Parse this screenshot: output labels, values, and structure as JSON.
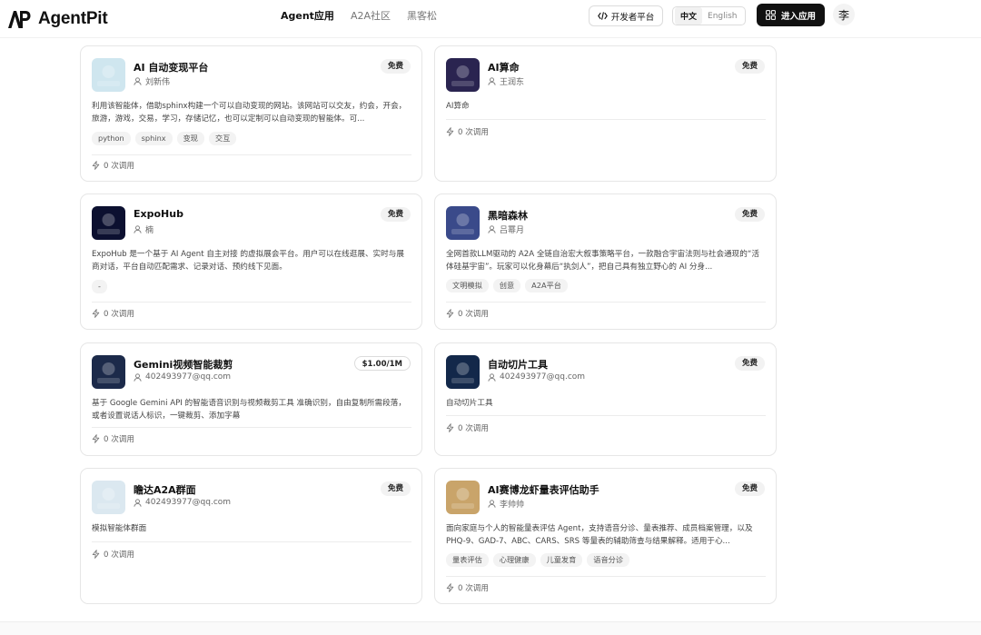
{
  "brand": {
    "name": "AgentPit"
  },
  "nav": {
    "items": [
      "Agent应用",
      "A2A社区",
      "黑客松"
    ]
  },
  "header": {
    "dev_platform": "开发者平台",
    "lang_zh": "中文",
    "lang_en": "English",
    "enter_app": "进入应用",
    "avatar": "李"
  },
  "cards": [
    {
      "title": "AI 自动变现平台",
      "author": "刘新伟",
      "price": "免费",
      "description": "利用该智能体，借助sphinx构建一个可以自动变现的网站。该网站可以交友，约会，开会，旅游，游戏，交易，学习，存储记忆，也可以定制可以自动变现的智能体。可...",
      "tags": [
        "python",
        "sphinx",
        "变现",
        "交互"
      ],
      "calls": "0 次调用",
      "thumb_color": "#cfe6ef"
    },
    {
      "title": "AI算命",
      "author": "王润东",
      "price": "免费",
      "description": "AI算命",
      "tags": [],
      "calls": "0 次调用",
      "thumb_color": "#2a2450"
    },
    {
      "title": "ExpoHub",
      "author": "楠",
      "price": "免费",
      "description": "ExpoHub 是一个基于 AI Agent 自主对接 的虚拟展会平台。用户可以在线逛展、实时与展商对话，平台自动匹配需求、记录对话、预约线下见面。",
      "tags": [
        "-"
      ],
      "calls": "0 次调用",
      "thumb_color": "#0c1030"
    },
    {
      "title": "黑暗森林",
      "author": "吕幂月",
      "price": "免费",
      "description": "全网首款LLM驱动的 A2A 全链自治宏大叙事策略平台，一款融合宇宙法则与社会通现的“活体硅基宇宙”。玩家可以化身幕后“执剑人”，把自己具有独立野心的 AI 分身...",
      "tags": [
        "文明模拟",
        "创意",
        "A2A平台"
      ],
      "calls": "0 次调用",
      "thumb_color": "#3a4a8a"
    },
    {
      "title": "Gemini视频智能裁剪",
      "author": "402493977@qq.com",
      "price": "$1.00/1M",
      "description": "基于 Google Gemini API 的智能语音识别与视频裁剪工具 准确识别，自由复制所需段落，或者设置说话人标识，一键裁剪、添加字幕",
      "tags": [],
      "calls": "0 次调用",
      "thumb_color": "#1c2a4a"
    },
    {
      "title": "自动切片工具",
      "author": "402493977@qq.com",
      "price": "免费",
      "description": "自动切片工具",
      "tags": [],
      "calls": "0 次调用",
      "thumb_color": "#13284a"
    },
    {
      "title": "瞻达A2A群面",
      "author": "402493977@qq.com",
      "price": "免费",
      "description": "模拟智能体群面",
      "tags": [],
      "calls": "0 次调用",
      "thumb_color": "#dbe8f0"
    },
    {
      "title": "AI赛博龙虾量表评估助手",
      "author": "李帅帅",
      "price": "免费",
      "description": "面向家庭与个人的智能量表评估 Agent，支持语音分诊、量表推荐、成员档案管理，以及 PHQ-9、GAD-7、ABC、CARS、SRS 等量表的辅助筛查与结果解释。适用于心...",
      "tags": [
        "量表评估",
        "心理健康",
        "儿童发育",
        "语音分诊"
      ],
      "calls": "0 次调用",
      "thumb_color": "#c9a46a"
    }
  ]
}
